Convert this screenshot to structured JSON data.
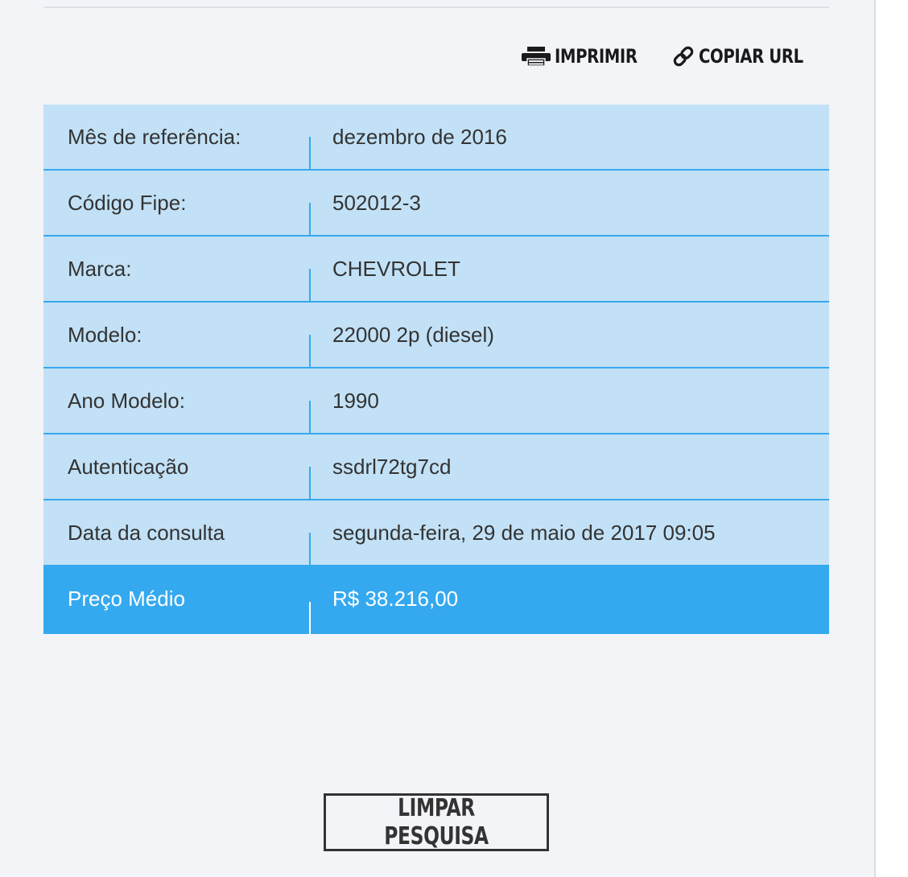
{
  "toolbar": {
    "print_label": "IMPRIMIR",
    "print_icon": "printer-icon",
    "copy_url_label": "COPIAR URL",
    "copy_url_icon": "link-icon"
  },
  "result": {
    "rows": [
      {
        "label": "Mês de referência:",
        "value": "dezembro de 2016"
      },
      {
        "label": "Código Fipe:",
        "value": "502012-3"
      },
      {
        "label": "Marca:",
        "value": "CHEVROLET"
      },
      {
        "label": "Modelo:",
        "value": "22000 2p (diesel)"
      },
      {
        "label": "Ano Modelo:",
        "value": "1990"
      },
      {
        "label": "Autenticação",
        "value": "ssdrl72tg7cd"
      },
      {
        "label": "Data da consulta",
        "value": "segunda-feira, 29 de maio de 2017 09:05"
      }
    ],
    "price": {
      "label": "Preço Médio",
      "value": "R$ 38.216,00"
    }
  },
  "clear_button": {
    "label": "LIMPAR PESQUISA"
  },
  "colors": {
    "row_background": "#c2e1f6",
    "accent": "#35a9ef",
    "page_background": "#f2f4f8",
    "text": "#333333"
  }
}
